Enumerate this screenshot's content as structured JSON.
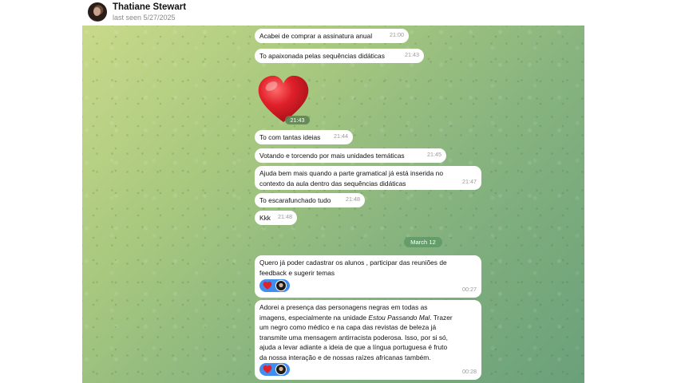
{
  "contact": {
    "name": "Thatiane Stewart",
    "last_seen": "last seen 5/27/2025"
  },
  "messages_before": [
    {
      "text": "Acabei de comprar a assinatura anual",
      "time": "21:00"
    },
    {
      "text": "To apaixonada pelas sequências didáticas",
      "time": "21:43"
    }
  ],
  "heart_message": {
    "emoji": "heart-emoji",
    "time": "21:43"
  },
  "messages_after": [
    {
      "text": "To com tantas ideias",
      "time": "21:44"
    },
    {
      "text": "Votando e torcendo por mais unidades temáticas",
      "time": "21:45"
    },
    {
      "text_line1": "Ajuda bem mais quando a parte gramatical já está inserida no",
      "text_line2": "contexto da aula dentro das sequências didáticas",
      "time": "21:47"
    },
    {
      "text": "To escarafunchado tudo",
      "time": "21:48"
    },
    {
      "text": "Kkk",
      "time": "21:48"
    }
  ],
  "date_separator": "March 12",
  "messages_march": [
    {
      "line1": "Quero já poder cadastrar os alunos , participar das reuniões de",
      "line2": "feedback e sugerir temas",
      "time": "00:27",
      "reaction": "heart"
    },
    {
      "line1": "Adorei a presença das personagens negras em todas as",
      "line2_a": "imagens, especialmente na unidade ",
      "line2_italic": "Estou Passando Mal",
      "line2_b": ". Trazer",
      "line3": "um negro como médico e na capa das revistas de beleza já",
      "line4": "transmite uma mensagem antirracista poderosa. Isso, por si só,",
      "line5": "ajuda a levar adiante a ideia de que a língua portuguesa é fruto",
      "line6": "da nossa interação e de nossas raízes africanas também.",
      "time": "00:28",
      "reaction": "heart"
    }
  ],
  "colors": {
    "reaction_bg": "#3f8ef0",
    "heart": "#e0202a",
    "bubble": "#ffffff"
  }
}
